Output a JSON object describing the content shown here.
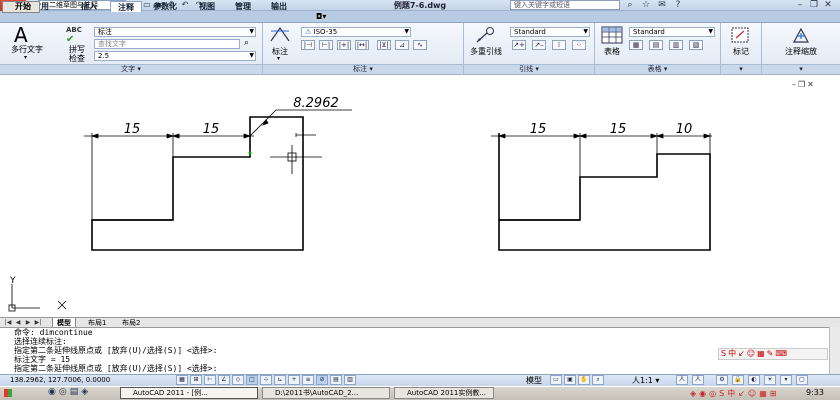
{
  "titlebar": {
    "workspace": "二维草图与注释",
    "doc_title": "例题7-6.dwg",
    "search_placeholder": "键入关键字或短语"
  },
  "tabs": [
    {
      "label": "常用"
    },
    {
      "label": "插入"
    },
    {
      "label": "注释",
      "active": true
    },
    {
      "label": "参数化"
    },
    {
      "label": "视图"
    },
    {
      "label": "管理"
    },
    {
      "label": "输出"
    }
  ],
  "ribbon": {
    "text_panel": {
      "mtext_label": "多行文字",
      "spell_label_1": "拼写",
      "spell_label_2": "检查",
      "style_value": "标注",
      "find_placeholder": "查找文字",
      "height_value": "2.5",
      "title": "文字"
    },
    "dim_panel": {
      "dim_label": "标注",
      "style_value": "ISO-35",
      "title": "标注"
    },
    "leader_panel": {
      "mleader_label": "多重引线",
      "style_value": "Standard",
      "title": "引线"
    },
    "table_panel": {
      "table_label": "表格",
      "style_value": "Standard",
      "title": "表格"
    },
    "markup_label": "标记",
    "scale_label": "注释缩放"
  },
  "drawing": {
    "left_dims": [
      "15",
      "15"
    ],
    "angled_dim": "8.2962",
    "right_dims": [
      "15",
      "15",
      "10"
    ],
    "ucs_y": "Y",
    "ucs_x": "X"
  },
  "layout_tabs": [
    {
      "label": "模型",
      "active": true
    },
    {
      "label": "布局1"
    },
    {
      "label": "布局2"
    }
  ],
  "command_lines": [
    "命令:  dimcontinue",
    "选择连续标注:",
    "指定第二条延伸线原点或 [放弃(U)/选择(S)] <选择>:",
    "标注文字 = 15",
    "指定第二条延伸线原点或 [放弃(U)/选择(S)] <选择>:"
  ],
  "status": {
    "coords": "138.2962, 127.7006, 0.0000",
    "model_label": "模型",
    "scale_label": "1:1"
  },
  "taskbar": {
    "start_label": "开始",
    "tasks": [
      {
        "label": "AutoCAD 2011 - [例...",
        "active": true
      },
      {
        "label": "D:\\2011书\\AutoCAD_2..."
      },
      {
        "label": "AutoCAD 2011实例教..."
      }
    ],
    "clock": "9:33"
  }
}
